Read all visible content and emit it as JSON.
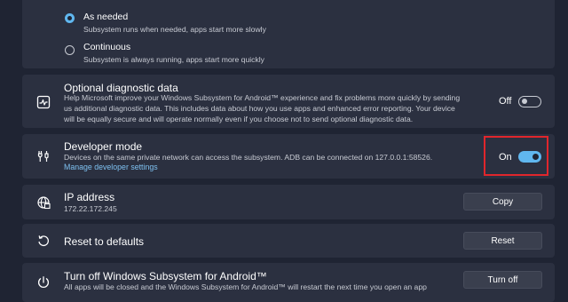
{
  "subsystem_resources": {
    "options": [
      {
        "title": "As needed",
        "description": "Subsystem runs when needed, apps start more slowly",
        "selected": true
      },
      {
        "title": "Continuous",
        "description": "Subsystem is always running, apps start more quickly",
        "selected": false
      }
    ]
  },
  "diagnostic": {
    "icon": "diagnostic-chart-icon",
    "title": "Optional diagnostic data",
    "description_lines": [
      "Help Microsoft improve your Windows Subsystem for Android™ experience and fix problems more quickly by sending",
      "us additional diagnostic data. This includes data about how you use apps and enhanced error reporting. Your device",
      "will be equally secure and will operate normally even if you choose not to send optional diagnostic data."
    ],
    "toggle_label": "Off",
    "toggle_on": false
  },
  "developer_mode": {
    "icon": "developer-tools-icon",
    "title": "Developer mode",
    "description": "Devices on the same private network can access the subsystem. ADB can be connected on 127.0.0.1:58526.",
    "link": "Manage developer settings",
    "toggle_label": "On",
    "toggle_on": true,
    "highlight_color": "#e0262c"
  },
  "ip_address": {
    "icon": "globe-network-icon",
    "title": "IP address",
    "value": "172.22.172.245",
    "button": "Copy"
  },
  "reset": {
    "icon": "reset-icon",
    "title": "Reset to defaults",
    "button": "Reset"
  },
  "turn_off": {
    "icon": "power-icon",
    "title": "Turn off Windows Subsystem for Android™",
    "description": "All apps will be closed and the Windows Subsystem for Android™ will restart the next time you open an app",
    "button": "Turn off"
  },
  "colors": {
    "background": "#1f2433",
    "card": "#2b3040",
    "accent": "#60b7ef",
    "link": "#7ec0f0",
    "highlight": "#e0262c"
  }
}
